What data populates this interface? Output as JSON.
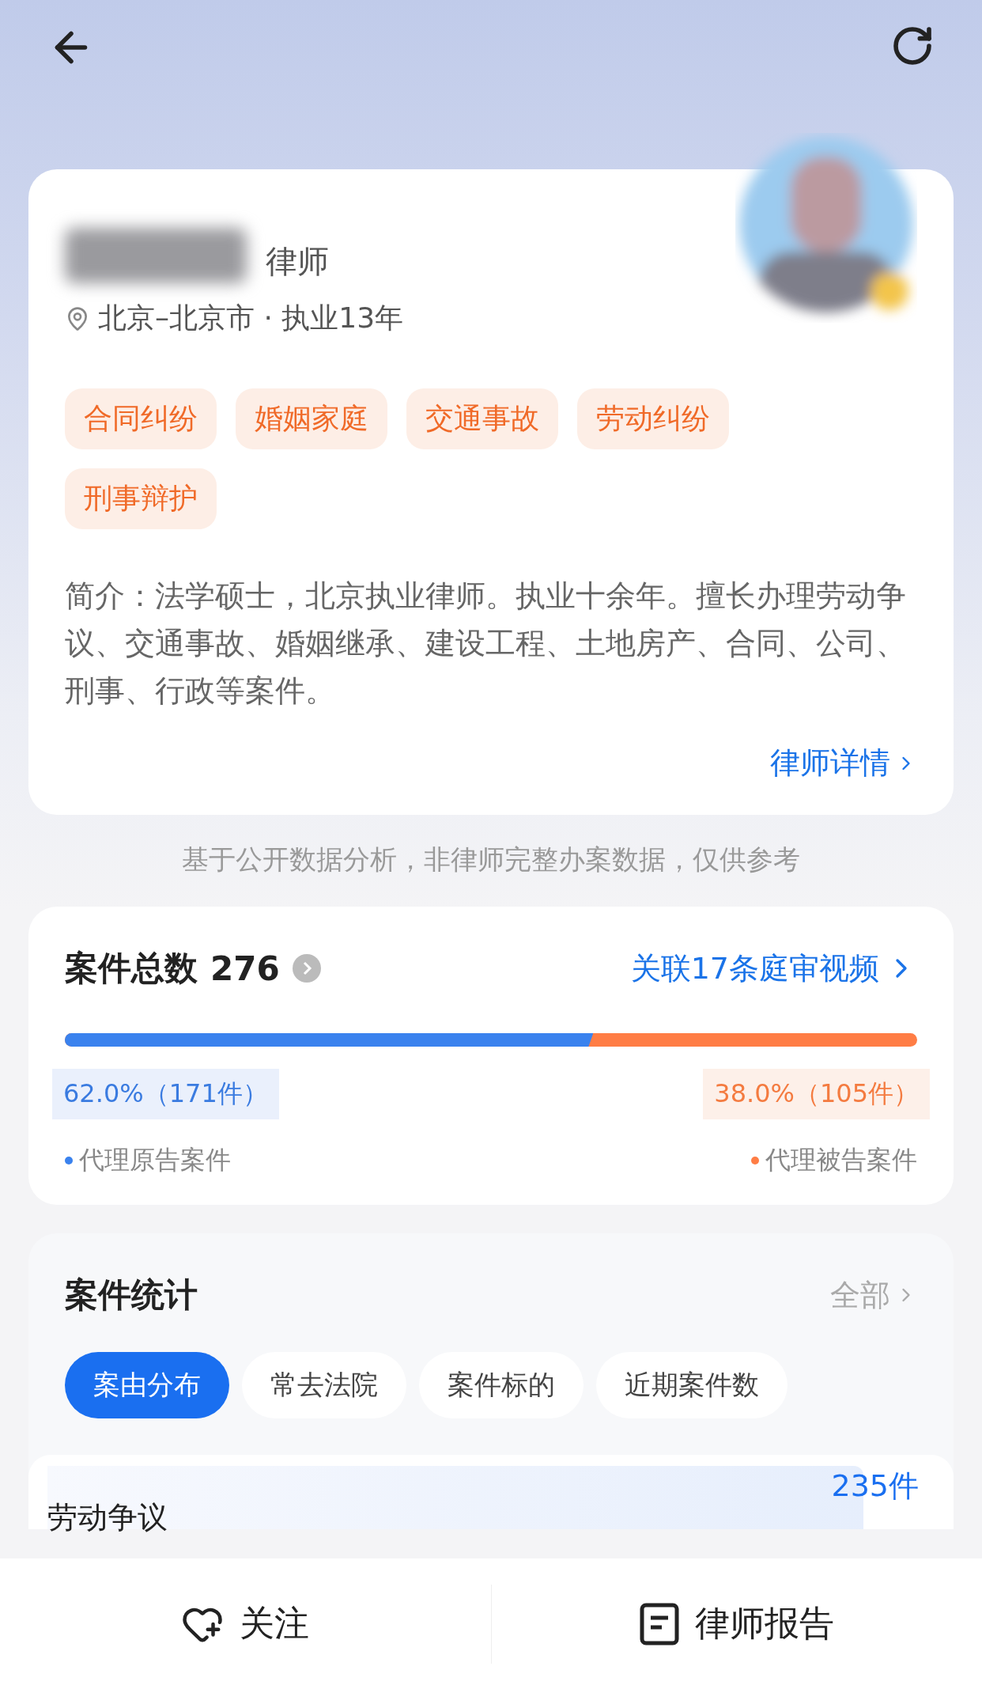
{
  "profile": {
    "title": "律师",
    "location": "北京–北京市 · 执业13年",
    "tags": [
      "合同纠纷",
      "婚姻家庭",
      "交通事故",
      "劳动纠纷",
      "刑事辩护"
    ],
    "intro": "简介：法学硕士，北京执业律师。执业十余年。擅长办理劳动争议、交通事故、婚姻继承、建设工程、土地房产、合同、公司、刑事、行政等案件。",
    "detail_link": "律师详情"
  },
  "disclaimer": "基于公开数据分析，非律师完整办案数据，仅供参考",
  "case_total": {
    "title": "案件总数",
    "count": "276",
    "video_link": "关联17条庭审视频",
    "plaintiff": {
      "level": 0.62,
      "reading": "62.0%（171件）",
      "legend": "代理原告案件"
    },
    "defendant": {
      "reading": "38.0%（105件）",
      "legend": "代理被告案件"
    }
  },
  "case_stats": {
    "title": "案件统计",
    "all_link": "全部",
    "tabs": [
      {
        "label": "案由分布",
        "selected": true
      },
      {
        "label": "常去法院",
        "selected": false
      },
      {
        "label": "案件标的",
        "selected": false
      },
      {
        "label": "近期案件数",
        "selected": false
      }
    ],
    "rows": [
      {
        "name": "劳动争议",
        "count": "235件"
      }
    ]
  },
  "bottom_bar": {
    "follow": "关注",
    "report": "律师报告"
  }
}
